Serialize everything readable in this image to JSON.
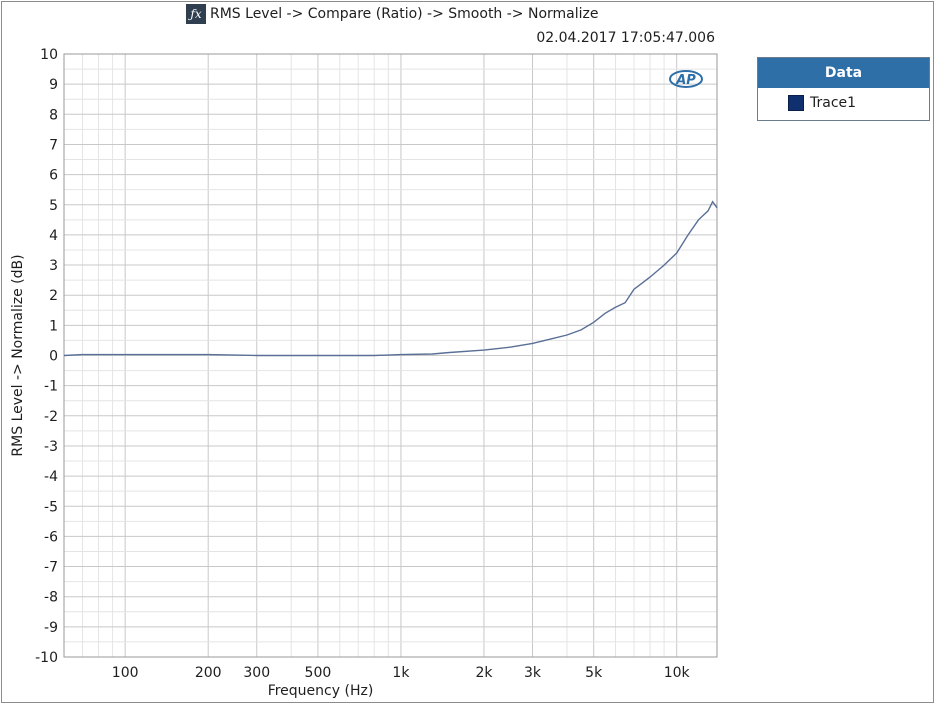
{
  "title": "RMS Level -> Compare (Ratio) -> Smooth -> Normalize",
  "timestamp": "02.04.2017 17:05:47.006",
  "logo_text": "AP",
  "legend": {
    "header": "Data",
    "items": [
      {
        "label": "Trace1",
        "color": "#0f2f6f"
      }
    ]
  },
  "colors": {
    "trace": "#5a6f96",
    "grid_major": "#c8c8c8",
    "grid_minor": "#e4e4e4",
    "legend_header": "#2f6fa8"
  },
  "chart_data": {
    "type": "line",
    "xlabel": "Frequency (Hz)",
    "ylabel": "RMS Level -> Normalize (dB)",
    "x_scale": "log",
    "xlim": [
      60,
      14000
    ],
    "ylim": [
      -10,
      10
    ],
    "grid": true,
    "x_ticks": [
      {
        "value": 100,
        "label": "100"
      },
      {
        "value": 200,
        "label": "200"
      },
      {
        "value": 300,
        "label": "300"
      },
      {
        "value": 500,
        "label": "500"
      },
      {
        "value": 1000,
        "label": "1k"
      },
      {
        "value": 2000,
        "label": "2k"
      },
      {
        "value": 3000,
        "label": "3k"
      },
      {
        "value": 5000,
        "label": "5k"
      },
      {
        "value": 10000,
        "label": "10k"
      }
    ],
    "y_ticks": [
      10,
      9,
      8,
      7,
      6,
      5,
      4,
      3,
      2,
      1,
      0,
      -1,
      -2,
      -3,
      -4,
      -5,
      -6,
      -7,
      -8,
      -9,
      -10
    ],
    "series": [
      {
        "name": "Trace1",
        "x": [
          60,
          70,
          100,
          200,
          300,
          500,
          800,
          1000,
          1300,
          1500,
          2000,
          2500,
          3000,
          3500,
          4000,
          4500,
          5000,
          5500,
          6000,
          6500,
          7000,
          7500,
          8000,
          9000,
          10000,
          11000,
          12000,
          13000,
          13500,
          14000
        ],
        "y": [
          0.0,
          0.03,
          0.03,
          0.03,
          0.0,
          0.0,
          0.0,
          0.03,
          0.05,
          0.1,
          0.18,
          0.28,
          0.4,
          0.55,
          0.68,
          0.85,
          1.1,
          1.4,
          1.6,
          1.75,
          2.2,
          2.4,
          2.6,
          3.0,
          3.4,
          4.0,
          4.5,
          4.8,
          5.1,
          4.9
        ]
      }
    ]
  }
}
